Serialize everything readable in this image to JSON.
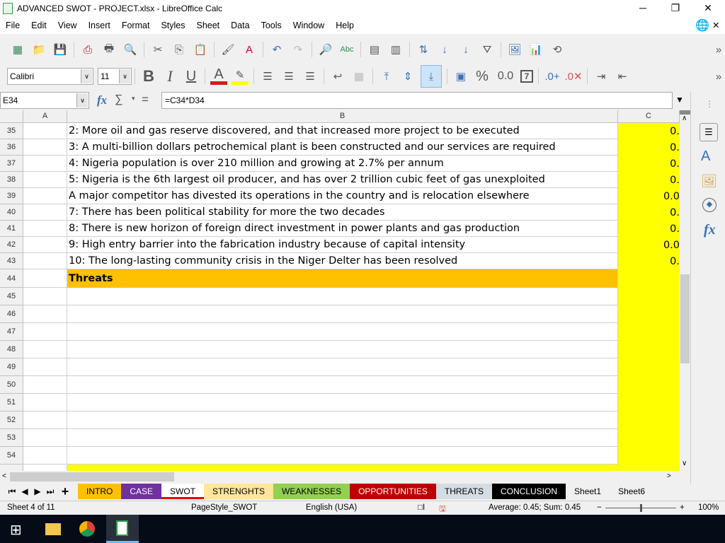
{
  "window": {
    "title": "ADVANCED SWOT - PROJECT.xlsx - LibreOffice Calc",
    "minimize": "─",
    "restore": "❐",
    "close": "✕"
  },
  "menu": [
    "File",
    "Edit",
    "View",
    "Insert",
    "Format",
    "Styles",
    "Sheet",
    "Data",
    "Tools",
    "Window",
    "Help"
  ],
  "format": {
    "font_name": "Calibri",
    "font_size": "11",
    "bold": "B",
    "italic": "I",
    "underline": "U",
    "percent": "%",
    "number": "0.0",
    "colors": {
      "font": "#c9211e",
      "highlight": "#ffff00"
    }
  },
  "formula_bar": {
    "name_box": "E34",
    "fx": "fx",
    "sum": "∑",
    "equals": "=",
    "formula": "=C34*D34"
  },
  "columns": [
    "A",
    "B",
    "C"
  ],
  "rows": [
    {
      "n": "35",
      "b": "2: More oil and gas reserve discovered, and that increased more project to be executed",
      "c": "0."
    },
    {
      "n": "36",
      "b": "3: A multi-billion dollars petrochemical plant is been constructed and our services are required",
      "c": "0."
    },
    {
      "n": "37",
      "b": "4: Nigeria population is over 210 million and growing at 2.7% per annum",
      "c": "0."
    },
    {
      "n": "38",
      "b": "5: Nigeria is the 6th largest oil producer, and has over 2 trillion cubic feet of gas unexploited",
      "c": "0."
    },
    {
      "n": "39",
      "b": "A major competitor has divested its operations in the country and is relocation elsewhere",
      "c": "0.0"
    },
    {
      "n": "40",
      "b": "7: There has been political stability for more the two decades",
      "c": "0."
    },
    {
      "n": "41",
      "b": "8: There is new horizon of foreign direct investment in power plants and  gas production",
      "c": "0."
    },
    {
      "n": "42",
      "b": "9: High entry barrier into the fabrication industry because of capital intensity",
      "c": "0.0"
    },
    {
      "n": "43",
      "b": "10: The long-lasting community crisis in the Niger Delter has been resolved",
      "c": "0."
    },
    {
      "n": "44",
      "b": "Threats",
      "c": ""
    },
    {
      "n": "45",
      "b": "",
      "c": ""
    },
    {
      "n": "46",
      "b": "",
      "c": ""
    },
    {
      "n": "47",
      "b": "",
      "c": ""
    },
    {
      "n": "48",
      "b": "",
      "c": ""
    },
    {
      "n": "49",
      "b": "",
      "c": ""
    },
    {
      "n": "50",
      "b": "",
      "c": ""
    },
    {
      "n": "51",
      "b": "",
      "c": ""
    },
    {
      "n": "52",
      "b": "",
      "c": ""
    },
    {
      "n": "53",
      "b": "",
      "c": ""
    },
    {
      "n": "54",
      "b": "",
      "c": ""
    }
  ],
  "sheet_tabs": [
    {
      "label": "INTRO",
      "bg": "#ffc000",
      "fg": "#000"
    },
    {
      "label": "CASE",
      "bg": "#7030a0",
      "fg": "#fff"
    },
    {
      "label": "SWOT",
      "bg": "#ffffff",
      "fg": "#000",
      "active": true
    },
    {
      "label": "STRENGHTS",
      "bg": "#ffe699",
      "fg": "#000"
    },
    {
      "label": "WEAKNESSES",
      "bg": "#92d050",
      "fg": "#000"
    },
    {
      "label": "OPPORTUNITIES",
      "bg": "#c00000",
      "fg": "#fff"
    },
    {
      "label": "THREATS",
      "bg": "#d6dce4",
      "fg": "#000"
    },
    {
      "label": "CONCLUSION",
      "bg": "#000000",
      "fg": "#fff"
    },
    {
      "label": "Sheet1",
      "bg": "#f0f0f0",
      "fg": "#000"
    },
    {
      "label": "Sheet6",
      "bg": "#f0f0f0",
      "fg": "#000"
    }
  ],
  "status": {
    "sheet": "Sheet 4 of 11",
    "page_style": "PageStyle_SWOT",
    "language": "English (USA)",
    "summary": "Average: 0.45; Sum: 0.45",
    "zoom": "100%",
    "zoom_level": 100
  },
  "colors": {
    "threats_header": "#ffc000",
    "column_c": "#ffff00"
  }
}
